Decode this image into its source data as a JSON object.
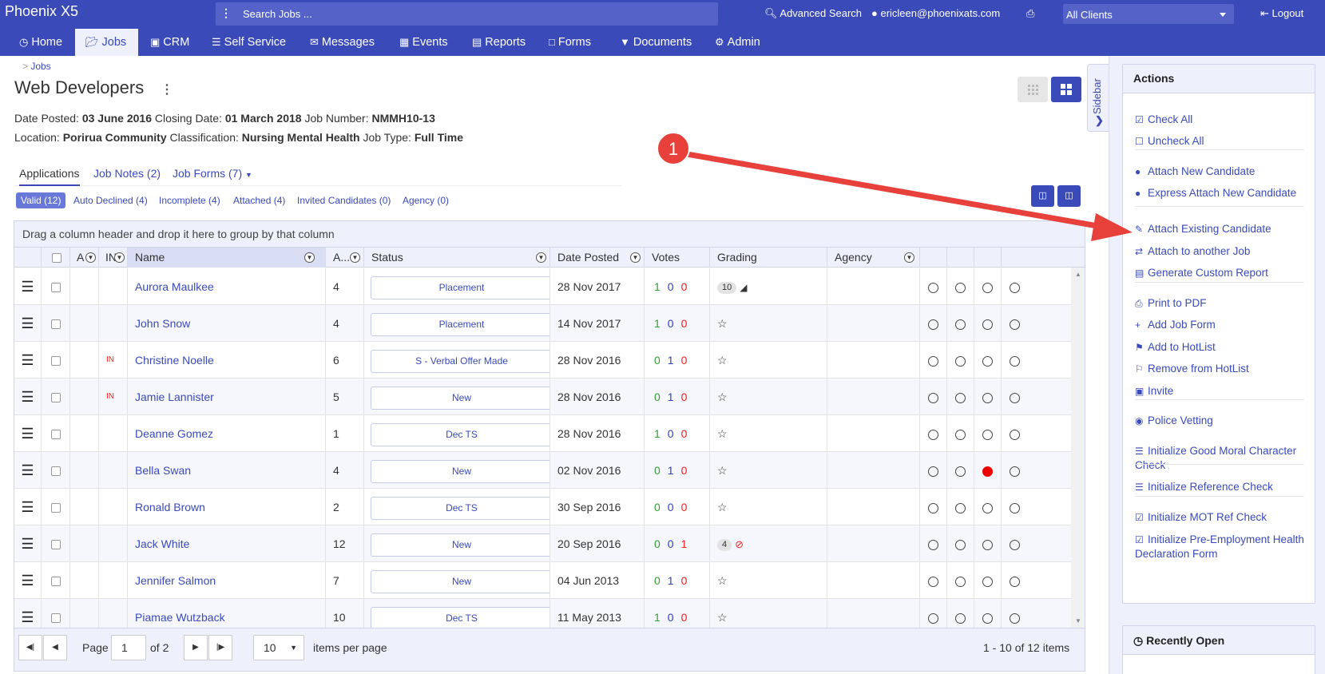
{
  "app": {
    "title": "Phoenix X5",
    "search_placeholder": "Search Jobs ...",
    "advanced_search": "Advanced Search",
    "user": "ericleen@phoenixats.com",
    "client_select": "All Clients",
    "logout": "Logout"
  },
  "nav": [
    {
      "label": "Home",
      "icon": "clock-icon"
    },
    {
      "label": "Jobs",
      "icon": "folder-open-icon"
    },
    {
      "label": "CRM",
      "icon": "briefcase-icon"
    },
    {
      "label": "Self Service",
      "icon": "server-icon"
    },
    {
      "label": "Messages",
      "icon": "envelope-icon"
    },
    {
      "label": "Events",
      "icon": "calendar-icon"
    },
    {
      "label": "Reports",
      "icon": "book-icon"
    },
    {
      "label": "Forms",
      "icon": "file-icon"
    },
    {
      "label": "Documents",
      "icon": "filter-icon"
    },
    {
      "label": "Admin",
      "icon": "gear-icon"
    }
  ],
  "breadcrumb": {
    "sep": ">",
    "item": "Jobs"
  },
  "job": {
    "title": "Web Developers",
    "date_posted_label": "Date Posted:",
    "date_posted": "03 June 2016",
    "closing_label": "Closing Date:",
    "closing": "01 March 2018",
    "number_label": "Job Number:",
    "number": "NMMH10-13",
    "location_label": "Location:",
    "location": "Porirua Community",
    "class_label": "Classification:",
    "classification": "Nursing Mental Health",
    "type_label": "Job Type:",
    "type": "Full Time"
  },
  "tabs": [
    "Applications",
    "Job Notes (2)",
    "Job Forms (7)"
  ],
  "filters": [
    "Valid (12)",
    "Auto Declined (4)",
    "Incomplete (4)",
    "Attached (4)",
    "Invited Candidates (0)",
    "Agency (0)"
  ],
  "grid": {
    "group_hint": "Drag a column header and drop it here to group by that column",
    "columns": {
      "a": "A",
      "in": "IN",
      "name": "Name",
      "age": "A...",
      "status": "Status",
      "date": "Date Posted",
      "votes": "Votes",
      "grading": "Grading",
      "agency": "Agency"
    },
    "rows": [
      {
        "in": "",
        "name": "Aurora Maulkee",
        "age": "4",
        "status": "Placement",
        "date": "28 Nov 2017",
        "votes": [
          "1",
          "0",
          "0"
        ],
        "grading": "10",
        "gicon": "megaphone-icon",
        "marks": [
          0,
          0,
          0,
          0
        ]
      },
      {
        "in": "",
        "name": "John Snow",
        "age": "4",
        "status": "Placement",
        "date": "14 Nov 2017",
        "votes": [
          "1",
          "0",
          "0"
        ],
        "grading": "☆",
        "gicon": "",
        "marks": [
          0,
          0,
          0,
          0
        ]
      },
      {
        "in": "IN",
        "name": "Christine Noelle",
        "age": "6",
        "status": "S - Verbal Offer Made",
        "date": "28 Nov 2016",
        "votes": [
          "0",
          "1",
          "0"
        ],
        "grading": "☆",
        "gicon": "",
        "marks": [
          0,
          0,
          0,
          0
        ]
      },
      {
        "in": "IN",
        "name": "Jamie Lannister",
        "age": "5",
        "status": "New",
        "date": "28 Nov 2016",
        "votes": [
          "0",
          "1",
          "0"
        ],
        "grading": "☆",
        "gicon": "",
        "marks": [
          0,
          0,
          0,
          0
        ]
      },
      {
        "in": "",
        "name": "Deanne Gomez",
        "age": "1",
        "status": "Dec TS",
        "date": "28 Nov 2016",
        "votes": [
          "1",
          "0",
          "0"
        ],
        "grading": "☆",
        "gicon": "",
        "marks": [
          0,
          0,
          0,
          0
        ]
      },
      {
        "in": "",
        "name": "Bella Swan",
        "age": "4",
        "status": "New",
        "date": "02 Nov 2016",
        "votes": [
          "0",
          "1",
          "0"
        ],
        "grading": "☆",
        "gicon": "",
        "marks": [
          0,
          0,
          1,
          0
        ]
      },
      {
        "in": "",
        "name": "Ronald Brown",
        "age": "2",
        "status": "Dec TS",
        "date": "30 Sep 2016",
        "votes": [
          "0",
          "0",
          "0"
        ],
        "grading": "☆",
        "gicon": "",
        "marks": [
          0,
          0,
          0,
          0
        ]
      },
      {
        "in": "",
        "name": "Jack White",
        "age": "12",
        "status": "New",
        "date": "20 Sep 2016",
        "votes": [
          "0",
          "0",
          "1"
        ],
        "grading": "4",
        "gicon": "ban-icon",
        "marks": [
          0,
          0,
          0,
          0
        ]
      },
      {
        "in": "",
        "name": "Jennifer Salmon",
        "age": "7",
        "status": "New",
        "date": "04 Jun 2013",
        "votes": [
          "0",
          "1",
          "0"
        ],
        "grading": "☆",
        "gicon": "",
        "marks": [
          0,
          0,
          0,
          0
        ]
      },
      {
        "in": "",
        "name": "Piamae Wutzback",
        "age": "10",
        "status": "Dec TS",
        "date": "11 May 2013",
        "votes": [
          "1",
          "0",
          "0"
        ],
        "grading": "☆",
        "gicon": "",
        "marks": [
          0,
          0,
          0,
          0
        ]
      }
    ]
  },
  "pager": {
    "page_label": "Page",
    "page": "1",
    "of": "of 2",
    "per_page": "10",
    "per_page_label": "items per page",
    "summary": "1 - 10 of 12 items"
  },
  "sidebar_tab": "Sidebar",
  "actions": {
    "title": "Actions",
    "items": [
      "Check All",
      "Uncheck All",
      "Attach New Candidate",
      "Express Attach New Candidate",
      "Attach Existing Candidate",
      "Attach to another Job",
      "Generate Custom Report",
      "Print to PDF",
      "Add Job Form",
      "Add to HotList",
      "Remove from HotList",
      "Invite",
      "Police Vetting",
      "Initialize Good Moral Character Check",
      "Initialize Reference Check",
      "Initialize MOT Ref Check",
      "Initialize Pre-Employment Health Declaration Form"
    ]
  },
  "recent": {
    "title": "Recently Open"
  },
  "callout": {
    "number": "1",
    "color": "#e8413c"
  },
  "colors": {
    "brand": "#3a4ab8",
    "vote_yes": "#2e9e2e",
    "vote_neutral": "#2e3fbd",
    "vote_no": "#e22222"
  }
}
